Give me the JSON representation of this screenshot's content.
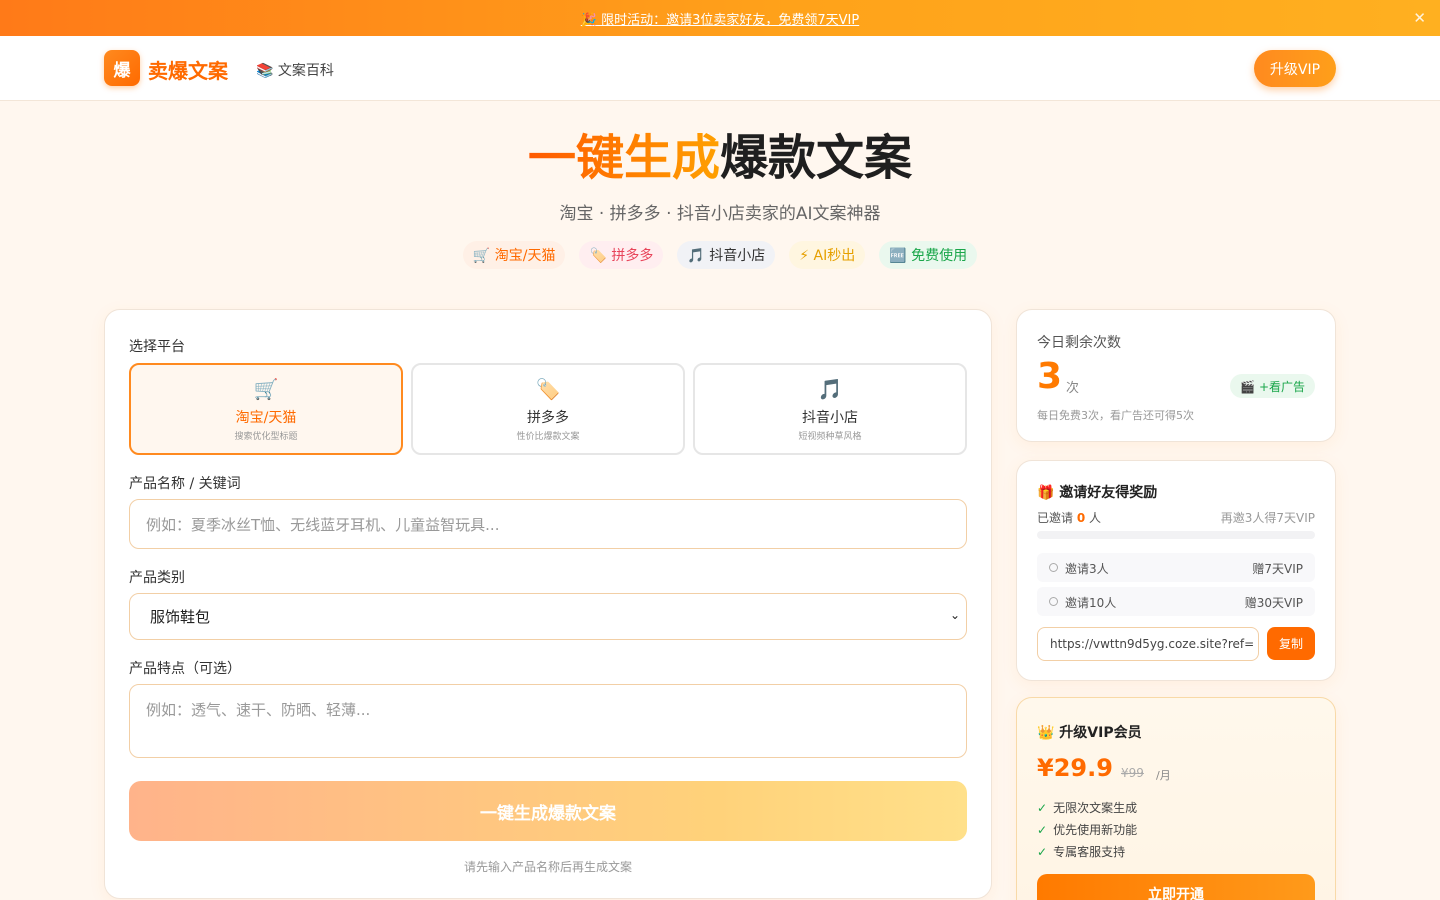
{
  "promo": {
    "text": "🎉 限时活动：邀请3位卖家好友，免费领7天VIP",
    "close": "✕"
  },
  "header": {
    "logo_mark": "爆",
    "logo_text": "卖爆文案",
    "nav_link": "📚 文案百科",
    "vip_button": "升级VIP"
  },
  "hero": {
    "title_highlight": "一键生成",
    "title_rest": "爆款文案",
    "subtitle": "淘宝 · 拼多多 · 抖音小店卖家的AI文案神器",
    "chips": [
      "🛒 淘宝/天猫",
      "🏷️ 拼多多",
      "🎵 抖音小店",
      "⚡ AI秒出",
      "🆓 免费使用"
    ]
  },
  "form": {
    "platform_label": "选择平台",
    "platforms": [
      {
        "icon": "🛒",
        "name": "淘宝/天猫",
        "desc": "搜索优化型标题"
      },
      {
        "icon": "🏷️",
        "name": "拼多多",
        "desc": "性价比爆款文案"
      },
      {
        "icon": "🎵",
        "name": "抖音小店",
        "desc": "短视频种草风格"
      }
    ],
    "product_label": "产品名称 / 关键词",
    "product_placeholder": "例如：夏季冰丝T恤、无线蓝牙耳机、儿童益智玩具...",
    "category_label": "产品类别",
    "category_value": "服饰鞋包",
    "features_label": "产品特点（可选）",
    "features_placeholder": "例如：透气、速干、防晒、轻薄...",
    "generate_button": "一键生成爆款文案",
    "hint": "请先输入产品名称后再生成文案"
  },
  "usage": {
    "title": "今日剩余次数",
    "count": "3",
    "unit": "次",
    "ad_button": "🎬 +看广告",
    "desc": "每日免费3次，看广告还可得5次"
  },
  "invite": {
    "title": "🎁 邀请好友得奖励",
    "count_prefix": "已邀请 ",
    "count": "0",
    "count_suffix": " 人",
    "need": "再邀3人得7天VIP",
    "progress": 0,
    "rewards": [
      {
        "name": "邀请3人",
        "prize": "赠7天VIP"
      },
      {
        "name": "邀请10人",
        "prize": "赠30天VIP"
      }
    ],
    "ref_link": "https://vwttn9d5yg.coze.site?ref=",
    "copy_button": "复制"
  },
  "vip": {
    "title": "👑 升级VIP会员",
    "price": "¥29.9",
    "old_price": "¥99",
    "per": "/月",
    "benefits": [
      "无限次文案生成",
      "优先使用新功能",
      "专属客服支持"
    ],
    "check": "✓",
    "open_button": "立即开通"
  },
  "colors": {
    "accent": "#ff6a00",
    "accent_light": "#ffa21a",
    "green": "#1aa64a",
    "bg": "#fff7ef"
  }
}
